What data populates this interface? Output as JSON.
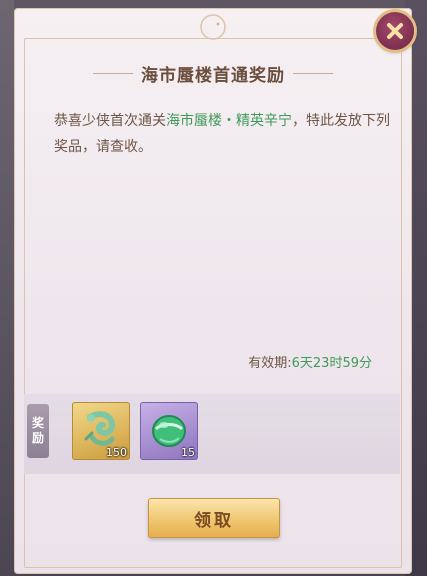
{
  "dialog": {
    "title": "海市蜃楼首通奖励",
    "message_before": "恭喜少侠首次通关",
    "message_highlight": "海市蜃楼・精英辛宁",
    "message_after": "，特此发放下列奖品，请查收。",
    "validity_label": "有效期:",
    "validity_time": "6天23时59分",
    "reward_tag_line1": "奖",
    "reward_tag_line2": "励",
    "claim_label": "领取"
  },
  "rewards": [
    {
      "icon": "jade-dragon-pendant-icon",
      "count": "150",
      "rarity": "gold"
    },
    {
      "icon": "green-jade-orb-icon",
      "count": "15",
      "rarity": "purple"
    }
  ],
  "colors": {
    "highlight": "#3f9a5a",
    "text": "#6e5646",
    "close_button": "#7c2f4e",
    "claim_button": "#f0c770"
  }
}
